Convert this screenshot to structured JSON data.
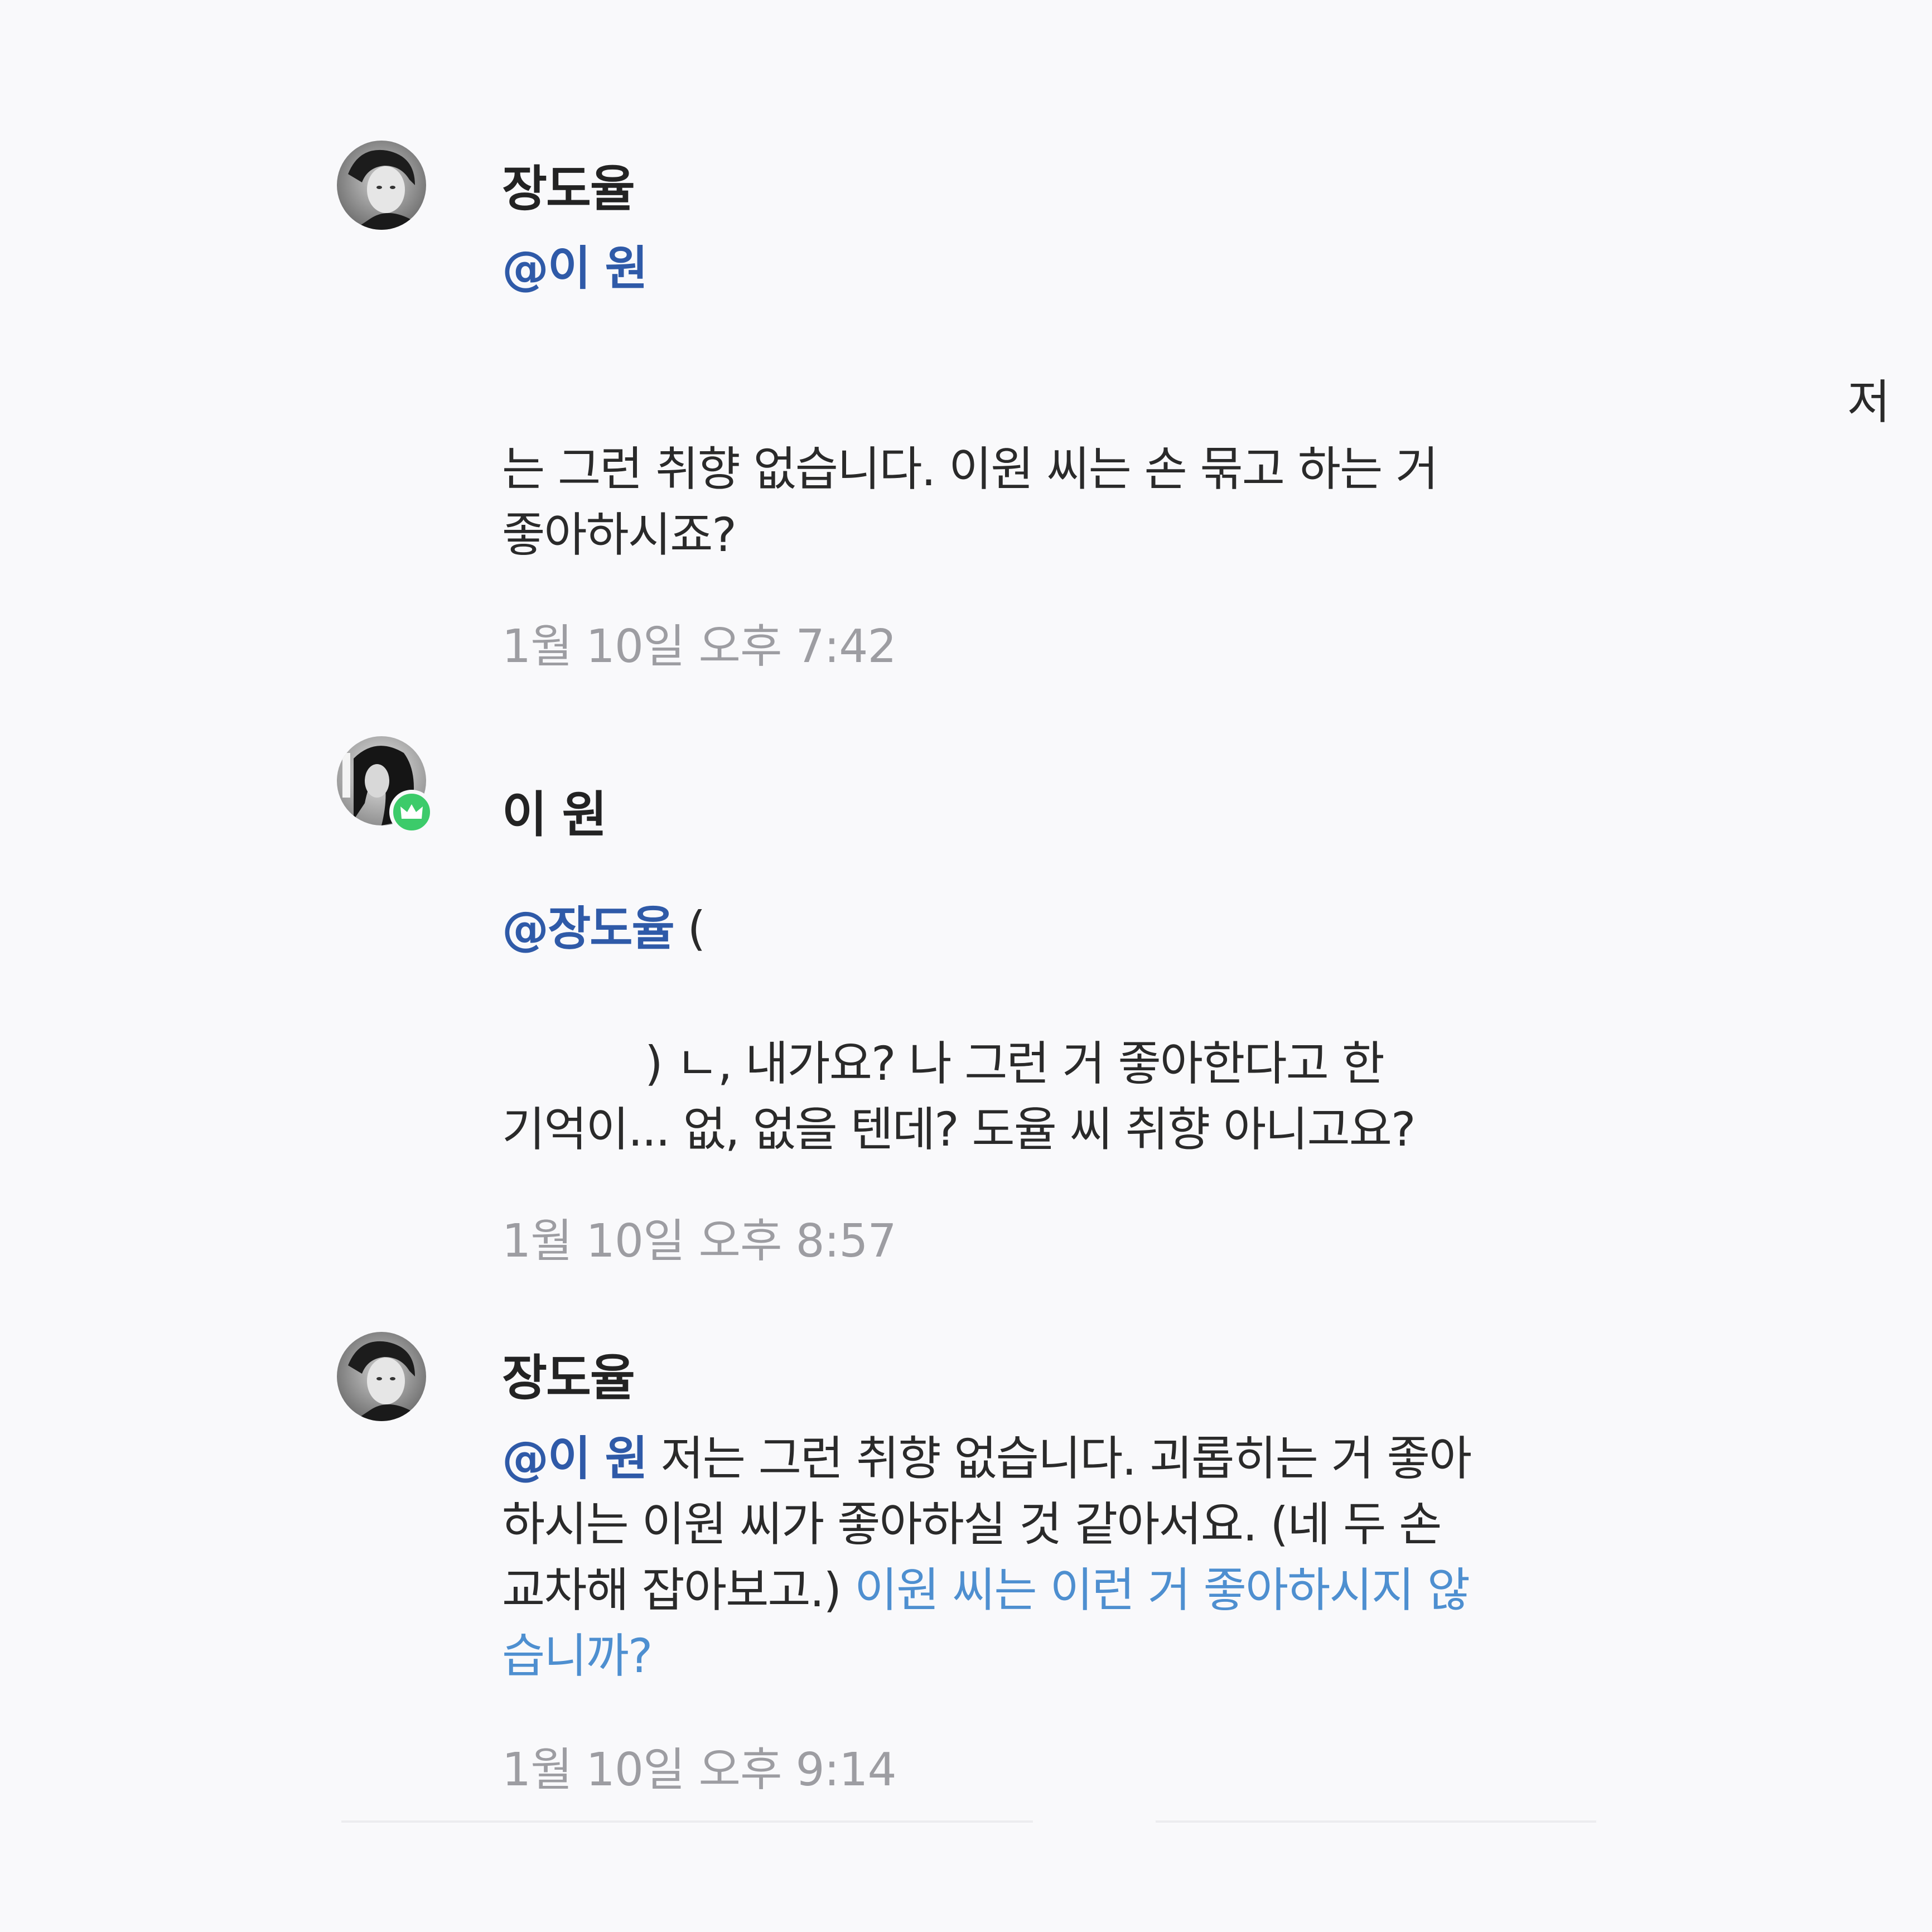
{
  "messages": [
    {
      "sender": "장도율",
      "mention": "@이 원",
      "line_first": "저",
      "lines": [
        "는 그런 취향 없습니다. 이원 씨는 손 묶고 하는 거",
        "좋아하시죠?"
      ],
      "timestamp": "1월 10일 오후 7:42"
    },
    {
      "sender": "이 원",
      "mention": "@장도율",
      "mention_after": " (",
      "lines": [
        ") ㄴ, 내가요? 나 그런 거 좋아한다고 한",
        "기억이... 없, 없을 텐데? 도율 씨 취향 아니고요?"
      ],
      "timestamp": "1월 10일 오후 8:57"
    },
    {
      "sender": "장도율",
      "mention": "@이 원",
      "line1_rest": " 저는 그런 취향 없습니다. 괴롭히는 거 좋아",
      "line2": "하시는 이원 씨가 좋아하실 것 같아서요. (네 두 손",
      "line3_plain": "교차해 잡아보고.) ",
      "line3_link": "이원 씨는 이런 거 좋아하시지 않",
      "line4_link": "습니까?",
      "timestamp": "1월 10일 오후 9:14"
    }
  ],
  "colors": {
    "background": "#f9f9fb",
    "mention": "#2f5aa8",
    "link": "#4e8fd0",
    "timestamp": "#9d9da2",
    "badge": "#3ccb6a"
  },
  "icons": {
    "badge": "crown-icon"
  }
}
